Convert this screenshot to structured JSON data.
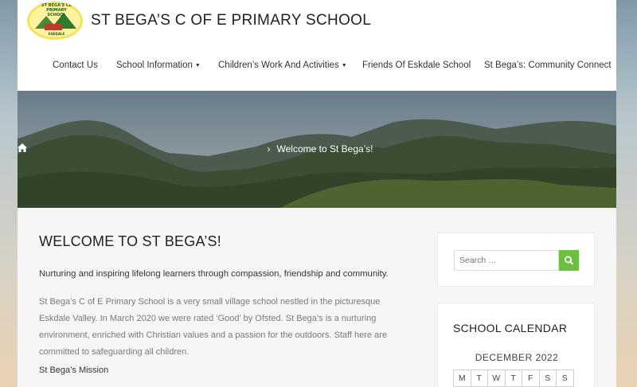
{
  "header": {
    "logo_text": "ST BEGA'S CE PRIMARY SCHOOL",
    "logo_sub": "ESKDALE",
    "site_title": "ST BEGA’S C OF E PRIMARY SCHOOL"
  },
  "nav": {
    "items": [
      {
        "label": "Contact Us",
        "dropdown": false
      },
      {
        "label": "School Information",
        "dropdown": true
      },
      {
        "label": "Children’s Work And Activities",
        "dropdown": true
      },
      {
        "label": "Friends Of Eskdale School",
        "dropdown": false
      },
      {
        "label": "St Bega’s: Community Connect",
        "dropdown": false
      }
    ],
    "caret": "▼"
  },
  "banner": {
    "breadcrumb_separator": "›",
    "breadcrumb_current": "Welcome to St Bega’s!"
  },
  "main": {
    "heading": "WELCOME TO ST BEGA’S!",
    "lead": "Nurturing and inspiring lifelong learners through compassion, friendship and community.",
    "paragraph": "St Bega’s C of E Primary School is a very small village school nestled in the picturesque Eskdale Valley. In March 2020 we were rated ‘Good’ by Ofsted. St Bega’s is a nurturing environment, enriched with Christian values and a passion for the outdoors. Staff here are committed to safeguarding all children.",
    "mission_label": "St Bega’s Mission"
  },
  "sidebar": {
    "search": {
      "placeholder": "Search …",
      "button_icon": "search-icon"
    },
    "calendar": {
      "title": "SCHOOL CALENDAR",
      "month": "DECEMBER 2022",
      "days": [
        "M",
        "T",
        "W",
        "T",
        "F",
        "S",
        "S"
      ]
    }
  },
  "colors": {
    "accent": "#6cbf3f",
    "text_dark": "#222222",
    "text_muted": "#7a7a7a"
  }
}
